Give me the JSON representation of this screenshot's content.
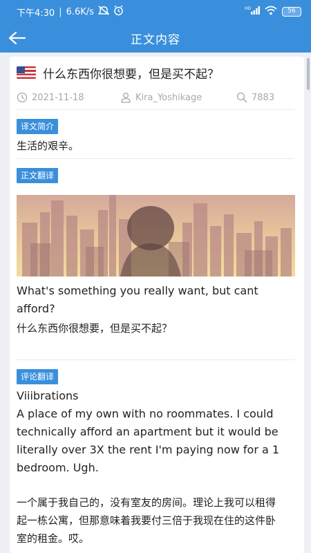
{
  "status_bar": {
    "time": "下午4:30",
    "speed": "6.6K/s",
    "signal_label": "HD",
    "battery": "56"
  },
  "header": {
    "title": "正文内容"
  },
  "article": {
    "title": "什么东西你很想要，但是买不起？",
    "date": "2021-11-18",
    "author": "Kira_Yoshikage",
    "views": "7883"
  },
  "sections": {
    "summary_tag": "译文简介",
    "summary_text": "生活的艰辛。",
    "body_tag": "正文翻译",
    "body_en": "What's something you really want, but cant afford?",
    "body_cn": "什么东西你很想要，但是买不起？",
    "comments_tag": "评论翻译"
  },
  "comment": {
    "user": "Viiibrations",
    "text_en_lines": [
      "A place of my own with no roommates. I could",
      "technically afford an apartment but it would be",
      "literally over 3X the rent I'm paying now for a 1",
      "bedroom. Ugh."
    ],
    "text_cn_lines": [
      "一个属于我自己的，没有室友的房间。理论上我可以租得",
      "起一栋公寓，但那意味着我要付三倍于我现在住的这件卧",
      "室的租金。哎。"
    ]
  },
  "icons": {
    "back": "back-arrow-icon",
    "flag": "us-flag-icon",
    "date": "clock-icon",
    "author": "user-icon",
    "views": "search-icon"
  },
  "colors": {
    "primary": "#3a8fdc",
    "meta_text": "#a3a8b2",
    "background": "#eef0f5"
  }
}
